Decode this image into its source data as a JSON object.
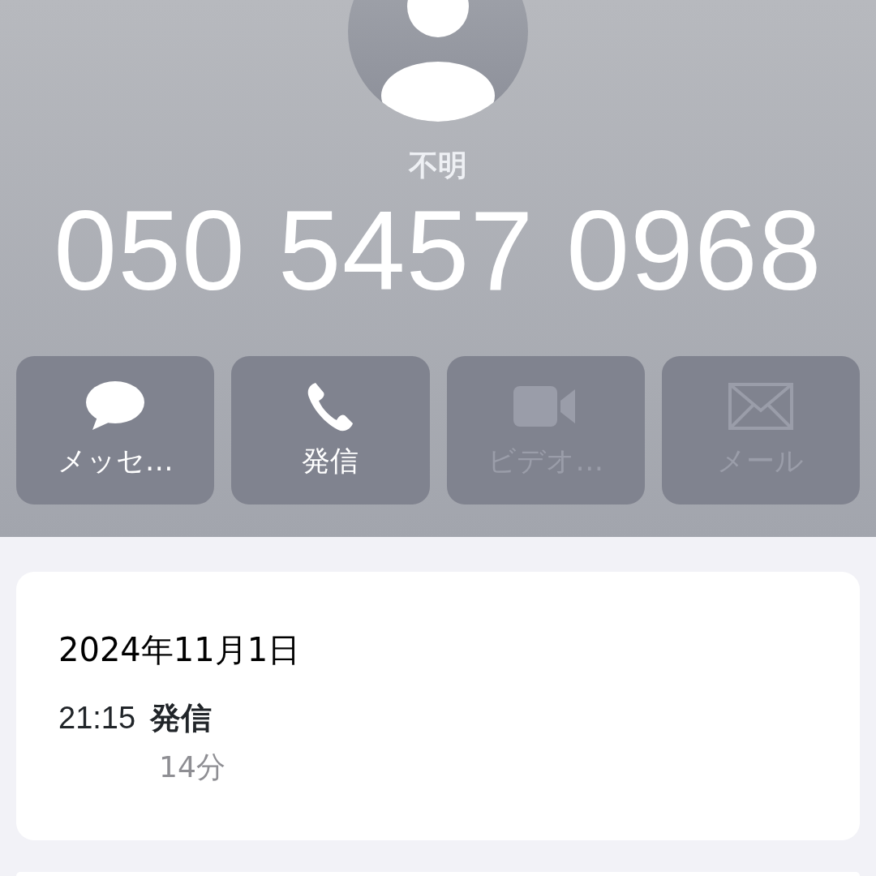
{
  "contact": {
    "name": "不明",
    "number": "050 5457 0968"
  },
  "actions": [
    {
      "kind": "message",
      "label": "メッセ…",
      "disabled": false
    },
    {
      "kind": "call",
      "label": "発信",
      "disabled": false
    },
    {
      "kind": "video",
      "label": "ビデオ…",
      "disabled": true
    },
    {
      "kind": "mail",
      "label": "メール",
      "disabled": true
    }
  ],
  "history": {
    "date": "2024年11月1日",
    "calls": [
      {
        "time": "21:15",
        "type": "発信",
        "duration": "14分"
      }
    ]
  }
}
